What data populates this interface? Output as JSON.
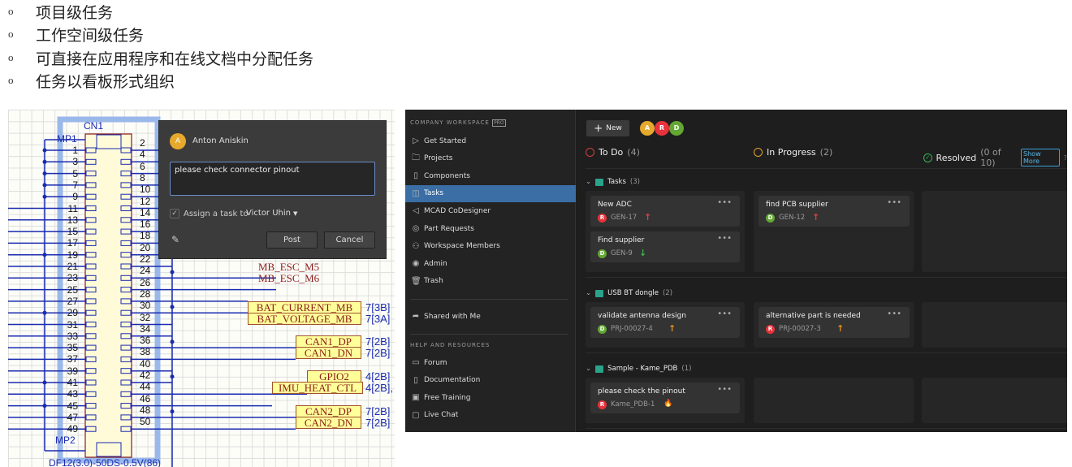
{
  "bullets": [
    "项目级任务",
    "工作空间级任务",
    "可直接在应用程序和在线文档中分配任务",
    "任务以看板形式组织"
  ],
  "bullet_glyph": "o",
  "schematic": {
    "designator": "CN1",
    "mp1": "MP1",
    "mp2": "MP2",
    "part": "DF12(3.0)-50DS-0.5V(86)",
    "left_pins": [
      "1",
      "3",
      "5",
      "7",
      "9",
      "11",
      "13",
      "15",
      "17",
      "19",
      "21",
      "23",
      "25",
      "27",
      "29",
      "31",
      "33",
      "35",
      "37",
      "39",
      "41",
      "43",
      "45",
      "47",
      "49"
    ],
    "right_pins": [
      "2",
      "4",
      "6",
      "8",
      "10",
      "12",
      "14",
      "16",
      "18",
      "20",
      "22",
      "24",
      "26",
      "28",
      "30",
      "32",
      "34",
      "36",
      "38",
      "40",
      "42",
      "44",
      "46",
      "48",
      "50"
    ],
    "nets": {
      "m5": "MB_ESC_M5",
      "m6": "MB_ESC_M6",
      "bc": "BAT_CURRENT_MB",
      "bv": "BAT_VOLTAGE_MB",
      "c1p": "CAN1_DP",
      "c1n": "CAN1_DN",
      "g2": "GPIO2",
      "imu": "IMU_HEAT_CTL",
      "c2p": "CAN2_DP",
      "c2n": "CAN2_DN"
    },
    "refs": {
      "bc": "7[3B]",
      "bv": "7[3A]",
      "c1p": "7[2B]",
      "c1n": "7[2B]",
      "g2": "4[2B]",
      "imu": "4[2B],",
      "c2p": "7[2B]",
      "c2n": "7[2B]"
    }
  },
  "comment": {
    "avatar": "A",
    "author": "Anton Aniskin",
    "text": "please check connector pinout",
    "assign_label": "Assign a task to",
    "assignee": "Victor Uhin",
    "post": "Post",
    "cancel": "Cancel",
    "checked": true
  },
  "app": {
    "workspace": "COMPANY WORKSPACE",
    "badge": "PRO",
    "nav": [
      {
        "label": "Get Started",
        "icon": "▷"
      },
      {
        "label": "Projects",
        "icon": "🗀"
      },
      {
        "label": "Components",
        "icon": "▯"
      },
      {
        "label": "Tasks",
        "icon": "◫",
        "active": true
      },
      {
        "label": "MCAD CoDesigner",
        "icon": "◁"
      },
      {
        "label": "Part Requests",
        "icon": "◎"
      },
      {
        "label": "Workspace Members",
        "icon": "⚇"
      },
      {
        "label": "Admin",
        "icon": "◉"
      },
      {
        "label": "Trash",
        "icon": "🗑"
      }
    ],
    "shared": "Shared with Me",
    "help_header": "HELP AND RESOURCES",
    "help": [
      {
        "label": "Forum",
        "icon": "▭"
      },
      {
        "label": "Documentation",
        "icon": "▯"
      },
      {
        "label": "Free Training",
        "icon": "▣"
      },
      {
        "label": "Live Chat",
        "icon": "▢"
      }
    ],
    "new_button": "New",
    "members": [
      {
        "i": "A",
        "color": "#e6a92b"
      },
      {
        "i": "R",
        "color": "#e8323c"
      },
      {
        "i": "D",
        "color": "#62a832"
      }
    ],
    "columns": [
      {
        "name": "To Do",
        "count": "(4)",
        "color": "#d2403a"
      },
      {
        "name": "In Progress",
        "count": "(2)",
        "color": "#e0a030"
      },
      {
        "name": "Resolved",
        "count": "(0 of 10)",
        "color": "#3ab45a",
        "show_more": "Show More"
      }
    ],
    "groups": [
      {
        "name": "Tasks",
        "count": "(3)",
        "cards": [
          {
            "col": 0,
            "title": "New ADC",
            "av": "R",
            "id": "GEN-17",
            "prio": "↑",
            "pc": "#e04040"
          },
          {
            "col": 0,
            "title": "Find supplier",
            "av": "D",
            "id": "GEN-9",
            "prio": "↓",
            "pc": "#40b050"
          },
          {
            "col": 1,
            "title": "find PCB supplier",
            "av": "D",
            "id": "GEN-12",
            "prio": "↑",
            "pc": "#e04040"
          }
        ]
      },
      {
        "name": "USB BT dongle",
        "count": "(2)",
        "cards": [
          {
            "col": 0,
            "title": "validate antenna design",
            "av": "D",
            "id": "PRJ-00027-4",
            "prio": "↑",
            "pc": "#e09020"
          },
          {
            "col": 1,
            "title": "alternative part is needed",
            "av": "R",
            "id": "PRJ-00027-3",
            "prio": "↑",
            "pc": "#e09020"
          }
        ]
      },
      {
        "name": "Sample - Kame_PDB",
        "count": "(1)",
        "cards": [
          {
            "col": 0,
            "title": "please check the pinout",
            "av": "R",
            "id": "Kame_PDB-1",
            "prio": "🔥",
            "pc": "#e04040"
          }
        ]
      }
    ]
  }
}
